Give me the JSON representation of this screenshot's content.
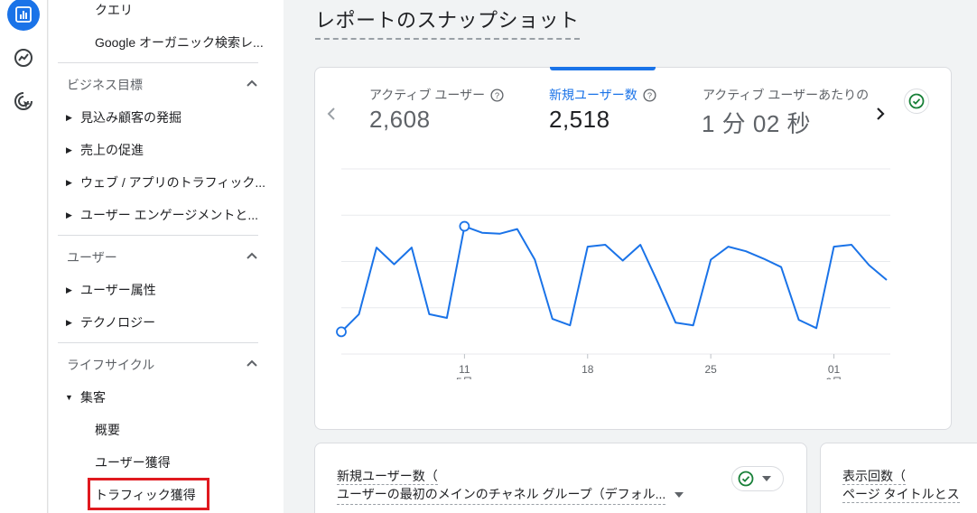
{
  "sidebar": {
    "top_items": [
      "クエリ",
      "Google オーガニック検索レ..."
    ],
    "sections": {
      "business": {
        "title": "ビジネス目標",
        "items": [
          "見込み顧客の発掘",
          "売上の促進",
          "ウェブ / アプリのトラフィック...",
          "ユーザー エンゲージメントと..."
        ]
      },
      "user": {
        "title": "ユーザー",
        "items": [
          "ユーザー属性",
          "テクノロジー"
        ]
      },
      "lifecycle": {
        "title": "ライフサイクル",
        "acquisition": "集客",
        "subitems": [
          "概要",
          "ユーザー獲得",
          "トラフィック獲得"
        ]
      }
    }
  },
  "page": {
    "title": "レポートのスナップショット"
  },
  "metrics": [
    {
      "label": "アクティブ ユーザー",
      "value": "2,608"
    },
    {
      "label": "新規ユーザー数",
      "value": "2,518"
    },
    {
      "label": "アクティブ ユーザーあたりの",
      "value": "1 分 02 秒"
    }
  ],
  "chart_data": {
    "type": "line",
    "title": "",
    "xlabel": "",
    "ylabel": "",
    "ylim": [
      0,
      200
    ],
    "yticks": [
      "200",
      "150",
      "100",
      "50",
      "0"
    ],
    "xticks": [
      {
        "day": "11",
        "month": "5月"
      },
      {
        "day": "18",
        "month": ""
      },
      {
        "day": "25",
        "month": ""
      },
      {
        "day": "01",
        "month": "6月"
      }
    ],
    "x": [
      "5/4",
      "5/5",
      "5/6",
      "5/7",
      "5/8",
      "5/9",
      "5/10",
      "5/11",
      "5/12",
      "5/13",
      "5/14",
      "5/15",
      "5/16",
      "5/17",
      "5/18",
      "5/19",
      "5/20",
      "5/21",
      "5/22",
      "5/23",
      "5/24",
      "5/25",
      "5/26",
      "5/27",
      "5/28",
      "5/29",
      "5/30",
      "5/31",
      "6/1",
      "6/2",
      "6/3",
      "6/4"
    ],
    "series": [
      {
        "values": [
          24,
          43,
          115,
          97,
          115,
          43,
          39,
          138,
          131,
          130,
          135,
          102,
          38,
          31,
          116,
          118,
          101,
          118,
          77,
          34,
          31,
          102,
          116,
          111,
          103,
          94,
          37,
          28,
          116,
          118,
          96,
          80
        ]
      }
    ],
    "highlighted_points": [
      0,
      7
    ],
    "grid": true,
    "color": "#1a73e8"
  },
  "bottom_cards": {
    "left": {
      "title_line1": "新規ユーザー数（",
      "title_line2": "ユーザーの最初のメインのチャネル グループ（デフォル..."
    },
    "right": {
      "title_line1": "表示回数（",
      "title_line2": "ページ タイトルとス"
    }
  },
  "colors": {
    "accent": "#1a73e8",
    "highlight_box": "#e0191f",
    "check_green": "#188038"
  }
}
